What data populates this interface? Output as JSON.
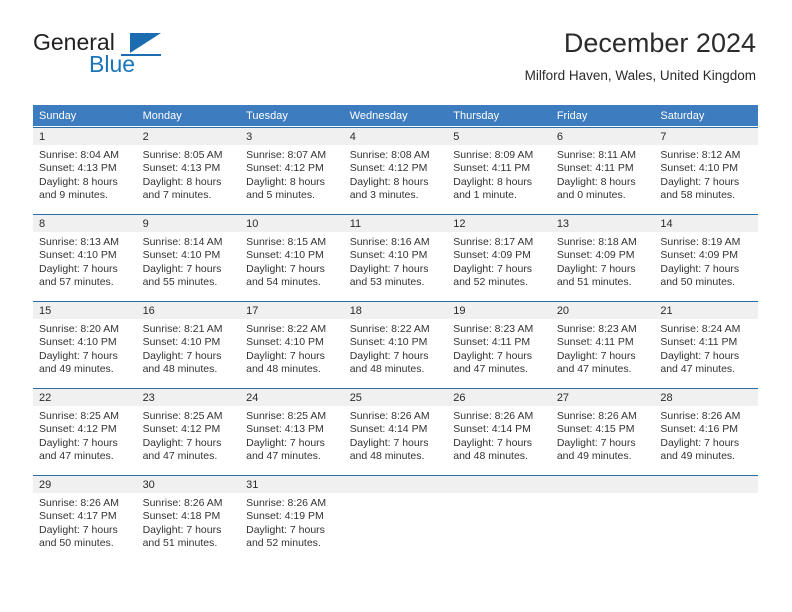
{
  "brand": {
    "name_part1": "General",
    "name_part2": "Blue",
    "logo_icon": "triangle-flag-icon"
  },
  "header": {
    "title": "December 2024",
    "location": "Milford Haven, Wales, United Kingdom"
  },
  "calendar": {
    "weekday_headers": [
      "Sunday",
      "Monday",
      "Tuesday",
      "Wednesday",
      "Thursday",
      "Friday",
      "Saturday"
    ],
    "header_bg": "#3c7cbf",
    "daynum_band_bg": "#f0f0f0",
    "cell_border": "#2e6ca8",
    "weeks": [
      [
        {
          "day": "1",
          "sunrise": "Sunrise: 8:04 AM",
          "sunset": "Sunset: 4:13 PM",
          "daylight_line1": "Daylight: 8 hours",
          "daylight_line2": "and 9 minutes."
        },
        {
          "day": "2",
          "sunrise": "Sunrise: 8:05 AM",
          "sunset": "Sunset: 4:13 PM",
          "daylight_line1": "Daylight: 8 hours",
          "daylight_line2": "and 7 minutes."
        },
        {
          "day": "3",
          "sunrise": "Sunrise: 8:07 AM",
          "sunset": "Sunset: 4:12 PM",
          "daylight_line1": "Daylight: 8 hours",
          "daylight_line2": "and 5 minutes."
        },
        {
          "day": "4",
          "sunrise": "Sunrise: 8:08 AM",
          "sunset": "Sunset: 4:12 PM",
          "daylight_line1": "Daylight: 8 hours",
          "daylight_line2": "and 3 minutes."
        },
        {
          "day": "5",
          "sunrise": "Sunrise: 8:09 AM",
          "sunset": "Sunset: 4:11 PM",
          "daylight_line1": "Daylight: 8 hours",
          "daylight_line2": "and 1 minute."
        },
        {
          "day": "6",
          "sunrise": "Sunrise: 8:11 AM",
          "sunset": "Sunset: 4:11 PM",
          "daylight_line1": "Daylight: 8 hours",
          "daylight_line2": "and 0 minutes."
        },
        {
          "day": "7",
          "sunrise": "Sunrise: 8:12 AM",
          "sunset": "Sunset: 4:10 PM",
          "daylight_line1": "Daylight: 7 hours",
          "daylight_line2": "and 58 minutes."
        }
      ],
      [
        {
          "day": "8",
          "sunrise": "Sunrise: 8:13 AM",
          "sunset": "Sunset: 4:10 PM",
          "daylight_line1": "Daylight: 7 hours",
          "daylight_line2": "and 57 minutes."
        },
        {
          "day": "9",
          "sunrise": "Sunrise: 8:14 AM",
          "sunset": "Sunset: 4:10 PM",
          "daylight_line1": "Daylight: 7 hours",
          "daylight_line2": "and 55 minutes."
        },
        {
          "day": "10",
          "sunrise": "Sunrise: 8:15 AM",
          "sunset": "Sunset: 4:10 PM",
          "daylight_line1": "Daylight: 7 hours",
          "daylight_line2": "and 54 minutes."
        },
        {
          "day": "11",
          "sunrise": "Sunrise: 8:16 AM",
          "sunset": "Sunset: 4:10 PM",
          "daylight_line1": "Daylight: 7 hours",
          "daylight_line2": "and 53 minutes."
        },
        {
          "day": "12",
          "sunrise": "Sunrise: 8:17 AM",
          "sunset": "Sunset: 4:09 PM",
          "daylight_line1": "Daylight: 7 hours",
          "daylight_line2": "and 52 minutes."
        },
        {
          "day": "13",
          "sunrise": "Sunrise: 8:18 AM",
          "sunset": "Sunset: 4:09 PM",
          "daylight_line1": "Daylight: 7 hours",
          "daylight_line2": "and 51 minutes."
        },
        {
          "day": "14",
          "sunrise": "Sunrise: 8:19 AM",
          "sunset": "Sunset: 4:09 PM",
          "daylight_line1": "Daylight: 7 hours",
          "daylight_line2": "and 50 minutes."
        }
      ],
      [
        {
          "day": "15",
          "sunrise": "Sunrise: 8:20 AM",
          "sunset": "Sunset: 4:10 PM",
          "daylight_line1": "Daylight: 7 hours",
          "daylight_line2": "and 49 minutes."
        },
        {
          "day": "16",
          "sunrise": "Sunrise: 8:21 AM",
          "sunset": "Sunset: 4:10 PM",
          "daylight_line1": "Daylight: 7 hours",
          "daylight_line2": "and 48 minutes."
        },
        {
          "day": "17",
          "sunrise": "Sunrise: 8:22 AM",
          "sunset": "Sunset: 4:10 PM",
          "daylight_line1": "Daylight: 7 hours",
          "daylight_line2": "and 48 minutes."
        },
        {
          "day": "18",
          "sunrise": "Sunrise: 8:22 AM",
          "sunset": "Sunset: 4:10 PM",
          "daylight_line1": "Daylight: 7 hours",
          "daylight_line2": "and 48 minutes."
        },
        {
          "day": "19",
          "sunrise": "Sunrise: 8:23 AM",
          "sunset": "Sunset: 4:11 PM",
          "daylight_line1": "Daylight: 7 hours",
          "daylight_line2": "and 47 minutes."
        },
        {
          "day": "20",
          "sunrise": "Sunrise: 8:23 AM",
          "sunset": "Sunset: 4:11 PM",
          "daylight_line1": "Daylight: 7 hours",
          "daylight_line2": "and 47 minutes."
        },
        {
          "day": "21",
          "sunrise": "Sunrise: 8:24 AM",
          "sunset": "Sunset: 4:11 PM",
          "daylight_line1": "Daylight: 7 hours",
          "daylight_line2": "and 47 minutes."
        }
      ],
      [
        {
          "day": "22",
          "sunrise": "Sunrise: 8:25 AM",
          "sunset": "Sunset: 4:12 PM",
          "daylight_line1": "Daylight: 7 hours",
          "daylight_line2": "and 47 minutes."
        },
        {
          "day": "23",
          "sunrise": "Sunrise: 8:25 AM",
          "sunset": "Sunset: 4:12 PM",
          "daylight_line1": "Daylight: 7 hours",
          "daylight_line2": "and 47 minutes."
        },
        {
          "day": "24",
          "sunrise": "Sunrise: 8:25 AM",
          "sunset": "Sunset: 4:13 PM",
          "daylight_line1": "Daylight: 7 hours",
          "daylight_line2": "and 47 minutes."
        },
        {
          "day": "25",
          "sunrise": "Sunrise: 8:26 AM",
          "sunset": "Sunset: 4:14 PM",
          "daylight_line1": "Daylight: 7 hours",
          "daylight_line2": "and 48 minutes."
        },
        {
          "day": "26",
          "sunrise": "Sunrise: 8:26 AM",
          "sunset": "Sunset: 4:14 PM",
          "daylight_line1": "Daylight: 7 hours",
          "daylight_line2": "and 48 minutes."
        },
        {
          "day": "27",
          "sunrise": "Sunrise: 8:26 AM",
          "sunset": "Sunset: 4:15 PM",
          "daylight_line1": "Daylight: 7 hours",
          "daylight_line2": "and 49 minutes."
        },
        {
          "day": "28",
          "sunrise": "Sunrise: 8:26 AM",
          "sunset": "Sunset: 4:16 PM",
          "daylight_line1": "Daylight: 7 hours",
          "daylight_line2": "and 49 minutes."
        }
      ],
      [
        {
          "day": "29",
          "sunrise": "Sunrise: 8:26 AM",
          "sunset": "Sunset: 4:17 PM",
          "daylight_line1": "Daylight: 7 hours",
          "daylight_line2": "and 50 minutes."
        },
        {
          "day": "30",
          "sunrise": "Sunrise: 8:26 AM",
          "sunset": "Sunset: 4:18 PM",
          "daylight_line1": "Daylight: 7 hours",
          "daylight_line2": "and 51 minutes."
        },
        {
          "day": "31",
          "sunrise": "Sunrise: 8:26 AM",
          "sunset": "Sunset: 4:19 PM",
          "daylight_line1": "Daylight: 7 hours",
          "daylight_line2": "and 52 minutes."
        },
        {
          "day": "",
          "sunrise": "",
          "sunset": "",
          "daylight_line1": "",
          "daylight_line2": ""
        },
        {
          "day": "",
          "sunrise": "",
          "sunset": "",
          "daylight_line1": "",
          "daylight_line2": ""
        },
        {
          "day": "",
          "sunrise": "",
          "sunset": "",
          "daylight_line1": "",
          "daylight_line2": ""
        },
        {
          "day": "",
          "sunrise": "",
          "sunset": "",
          "daylight_line1": "",
          "daylight_line2": ""
        }
      ]
    ]
  }
}
